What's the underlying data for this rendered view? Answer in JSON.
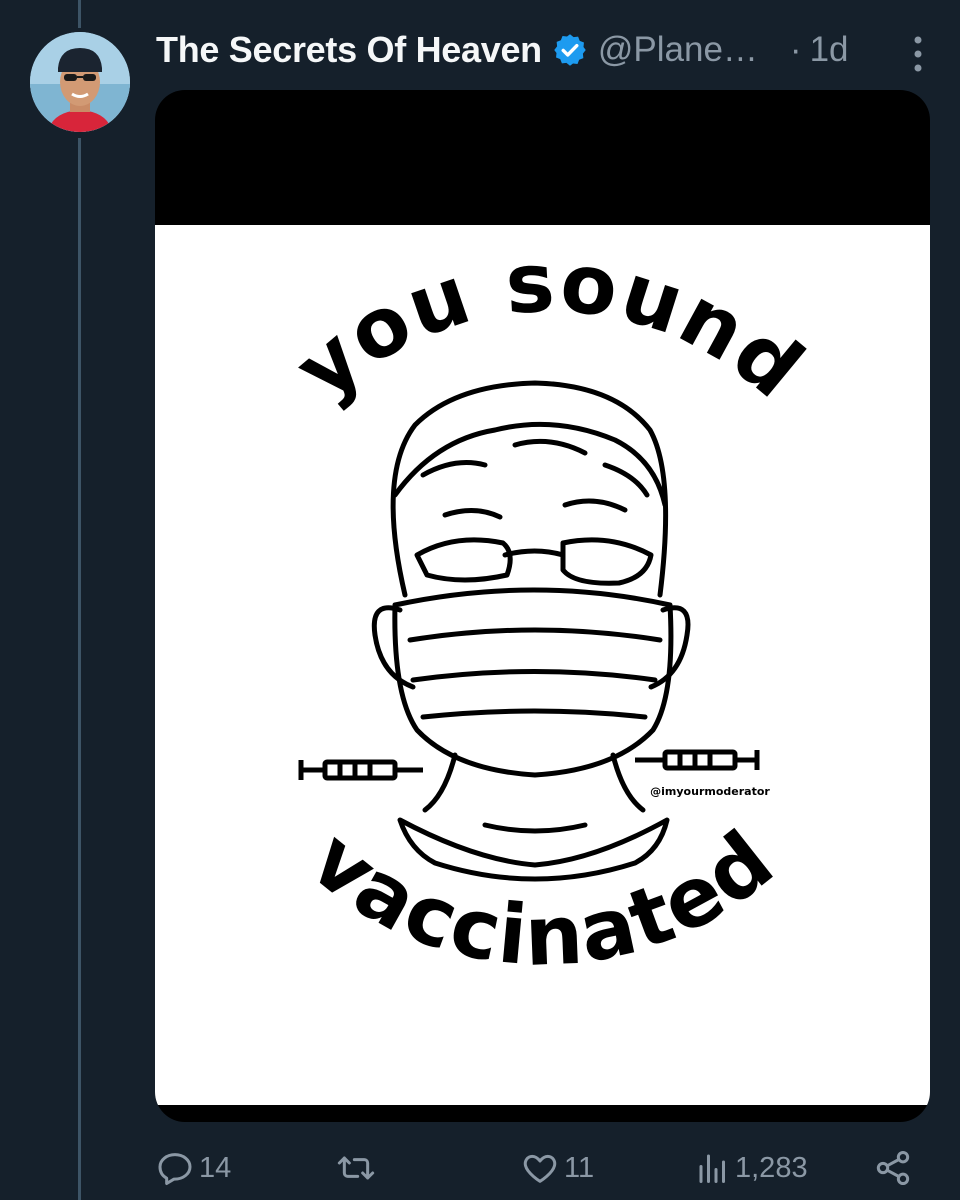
{
  "tweet": {
    "author_name": "The Secrets Of Heaven",
    "handle": "@Plane…",
    "separator": "·",
    "time": "1d",
    "verified": true
  },
  "image": {
    "top_text": "you sound",
    "bottom_text": "vaccinated",
    "credit": "@imyourmoderator"
  },
  "actions": {
    "replies": "14",
    "likes": "11",
    "views": "1,283"
  },
  "icons": [
    "more-icon",
    "verified-icon",
    "reply-icon",
    "retweet-icon",
    "like-icon",
    "views-icon",
    "share-icon"
  ],
  "colors": {
    "background": "#15202b",
    "verified": "#1d9bf0",
    "muted": "#8b98a5"
  }
}
